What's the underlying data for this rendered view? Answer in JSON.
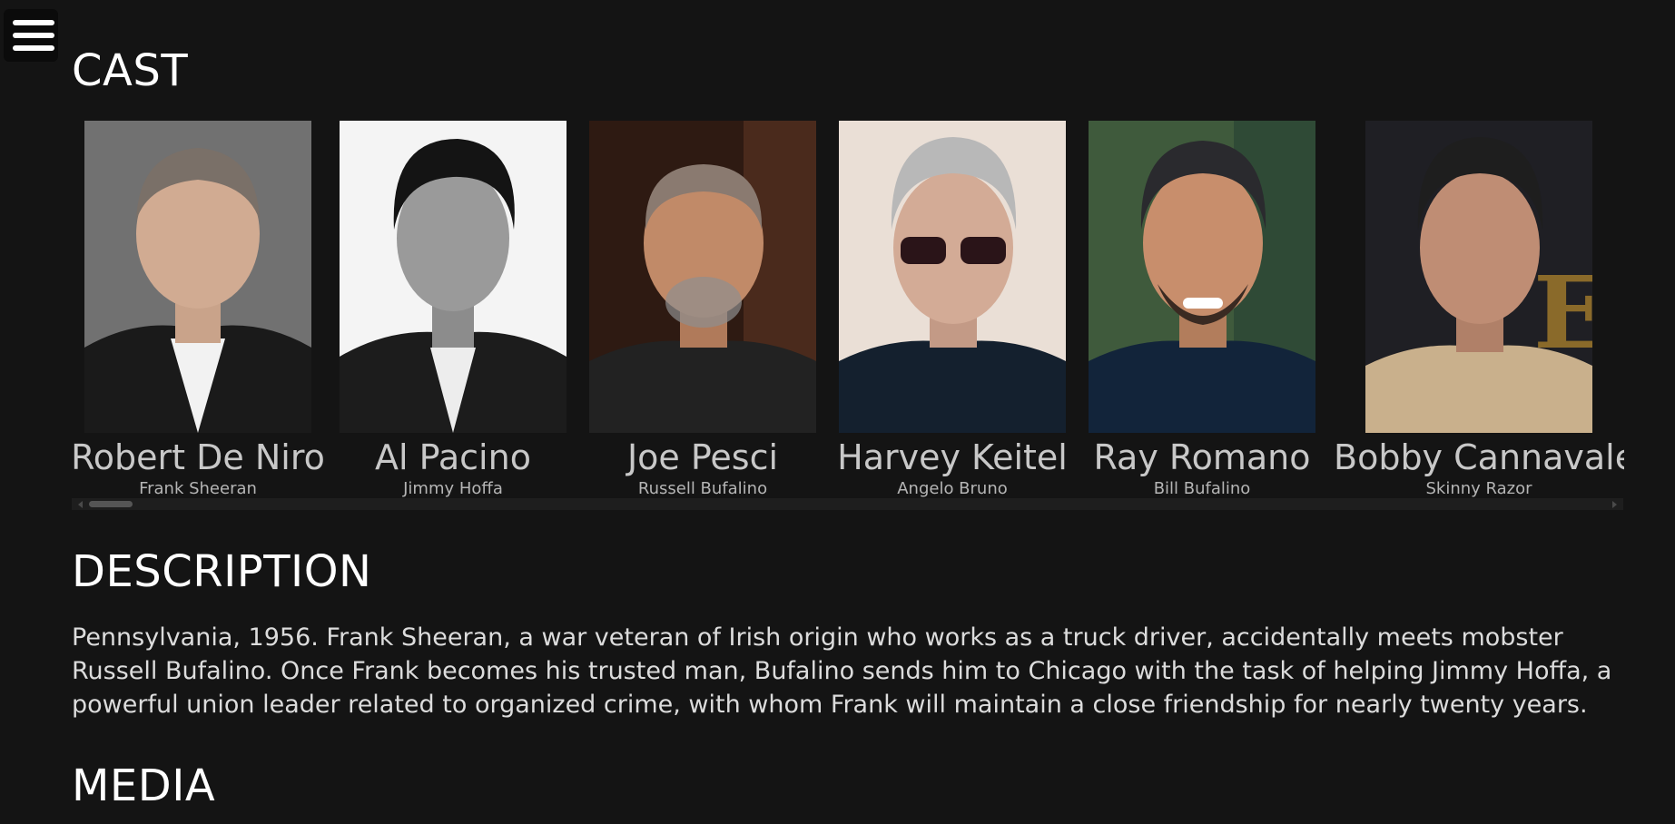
{
  "menu": {
    "icon": "hamburger-menu-icon"
  },
  "cast": {
    "title": "CAST",
    "members": [
      {
        "name": "Robert De Niro",
        "role": "Frank Sheeran"
      },
      {
        "name": "Al Pacino",
        "role": "Jimmy Hoffa"
      },
      {
        "name": "Joe Pesci",
        "role": "Russell Bufalino"
      },
      {
        "name": "Harvey Keitel",
        "role": "Angelo Bruno"
      },
      {
        "name": "Ray Romano",
        "role": "Bill Bufalino"
      },
      {
        "name": "Bobby Cannavale",
        "role": "Skinny Razor"
      }
    ]
  },
  "description": {
    "title": "DESCRIPTION",
    "text": "Pennsylvania, 1956. Frank Sheeran, a war veteran of Irish origin who works as a truck driver, accidentally meets mobster Russell Bufalino. Once Frank becomes his trusted man, Bufalino sends him to Chicago with the task of helping Jimmy Hoffa, a powerful union leader related to organized crime, with whom Frank will maintain a close friendship for nearly twenty years."
  },
  "media": {
    "title": "MEDIA"
  },
  "colors": {
    "background": "#141414",
    "heading": "#ffffff",
    "text": "#dcdcdc",
    "muted": "#b5b5b5"
  }
}
